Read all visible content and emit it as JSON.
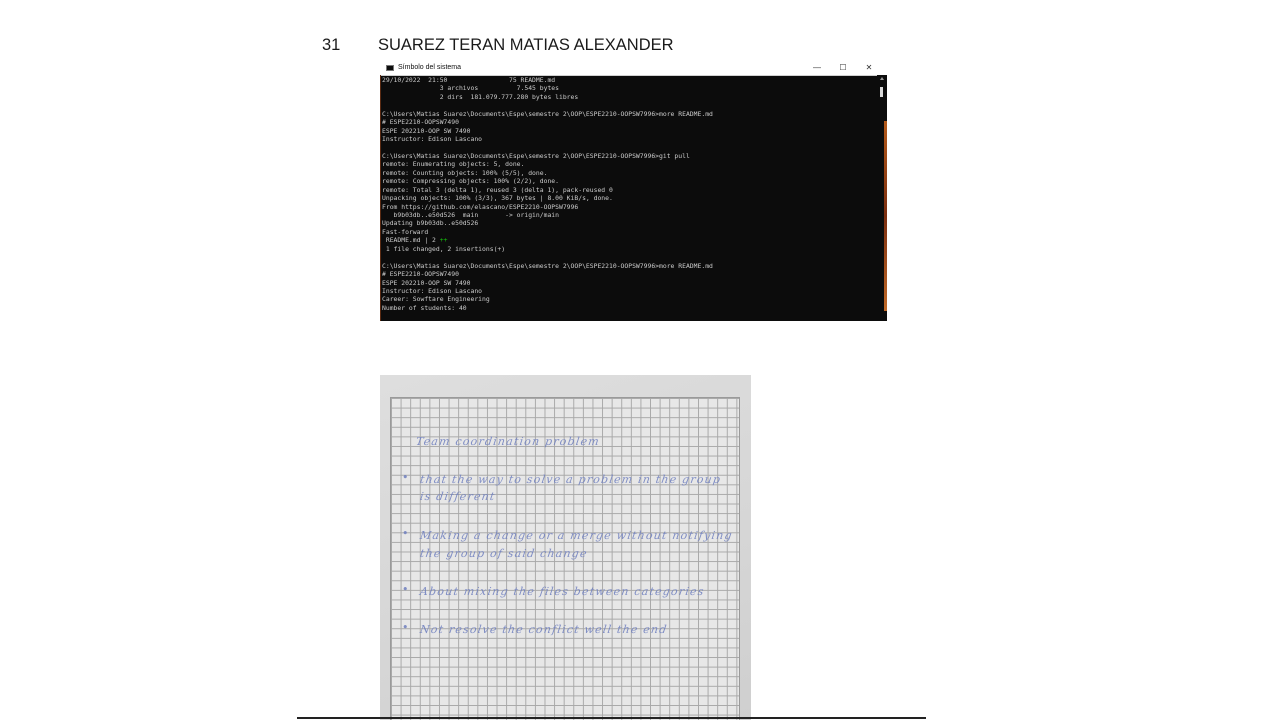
{
  "document": {
    "entry_number": "31",
    "student_name": "SUAREZ TERAN MATIAS ALEXANDER"
  },
  "terminal": {
    "window_title": "Símbolo del sistema",
    "controls": {
      "minimize": "—",
      "maximize": "☐",
      "close": "✕"
    },
    "lines": [
      "29/10/2022  21:50                75 README.md",
      "               3 archivos          7.545 bytes",
      "               2 dirs  181.079.777.280 bytes libres",
      "",
      "C:\\Users\\Matias Suarez\\Documents\\Espe\\semestre 2\\OOP\\ESPE2210-OOPSW7996>more README.md",
      "# ESPE2210-OOPSW7490",
      "ESPE 202210-OOP SW 7490",
      "Instructor: Edison Lascano",
      "",
      "C:\\Users\\Matias Suarez\\Documents\\Espe\\semestre 2\\OOP\\ESPE2210-OOPSW7996>git pull",
      "remote: Enumerating objects: 5, done.",
      "remote: Counting objects: 100% (5/5), done.",
      "remote: Compressing objects: 100% (2/2), done.",
      "remote: Total 3 (delta 1), reused 3 (delta 1), pack-reused 0",
      "Unpacking objects: 100% (3/3), 367 bytes | 8.00 KiB/s, done.",
      "From https://github.com/elascano/ESPE2210-OOPSW7996",
      "   b9b03db..e50d526  main       -> origin/main",
      "Updating b9b03db..e50d526",
      "Fast-forward",
      " README.md | 2 ",
      " 1 file changed, 2 insertions(+)",
      "",
      "C:\\Users\\Matias Suarez\\Documents\\Espe\\semestre 2\\OOP\\ESPE2210-OOPSW7996>more README.md",
      "# ESPE2210-OOPSW7490",
      "ESPE 202210-OOP SW 7490",
      "Instructor: Edison Lascano",
      "Career: Sowftare Engineering",
      "Number of students: 40"
    ],
    "diff_marker": "++",
    "colors": {
      "background": "#0c0c0c",
      "text": "#cccccc",
      "diff_added": "#16c60c"
    }
  },
  "notes_photo": {
    "title": "Team coordination problem",
    "bullet_symbol": "•",
    "lines": [
      "that the way to solve a problem in the group",
      "is different",
      "Making a change or a merge without notifying",
      "the group of said change",
      "About mixing the files between categories",
      "Not resolve the conflict well the end"
    ],
    "ink_color": "#6f7fbf"
  }
}
